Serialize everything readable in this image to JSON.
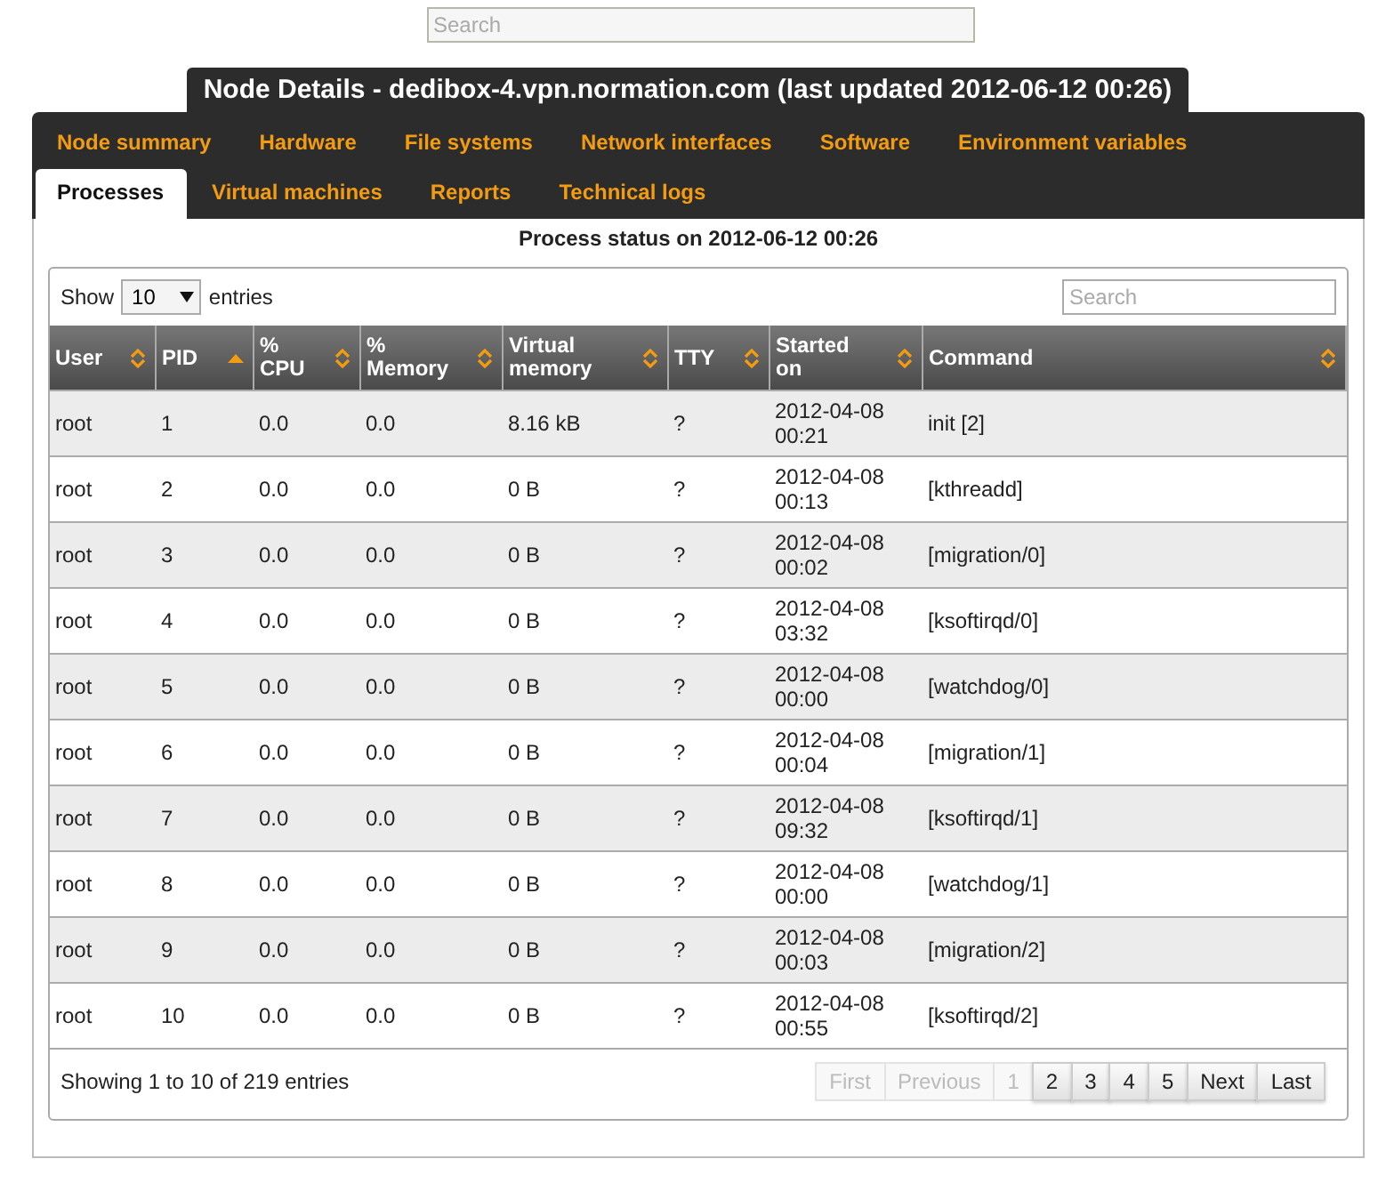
{
  "search": {
    "placeholder": "Search"
  },
  "title": "Node Details - dedibox-4.vpn.normation.com (last updated 2012-06-12 00:26)",
  "tabs": [
    {
      "label": "Node summary",
      "selected": false
    },
    {
      "label": "Hardware",
      "selected": false
    },
    {
      "label": "File systems",
      "selected": false
    },
    {
      "label": "Network interfaces",
      "selected": false
    },
    {
      "label": "Software",
      "selected": false
    },
    {
      "label": "Environment variables",
      "selected": false
    },
    {
      "label": "Processes",
      "selected": true
    },
    {
      "label": "Virtual machines",
      "selected": false
    },
    {
      "label": "Reports",
      "selected": false
    },
    {
      "label": "Technical logs",
      "selected": false
    }
  ],
  "panel_title": "Process status on 2012-06-12 00:26",
  "length_menu": {
    "before": "Show",
    "value": "10",
    "after": "entries"
  },
  "table_search": {
    "placeholder": "Search"
  },
  "table": {
    "columns": [
      {
        "label": "User",
        "sorted": false
      },
      {
        "label": "PID",
        "sorted": true
      },
      {
        "label": "% CPU",
        "sorted": false
      },
      {
        "label": "% Memory",
        "sorted": false
      },
      {
        "label": "Virtual memory",
        "sorted": false
      },
      {
        "label": "TTY",
        "sorted": false
      },
      {
        "label": "Started on",
        "sorted": false
      },
      {
        "label": "Command",
        "sorted": false
      }
    ],
    "rows": [
      [
        "root",
        "1",
        "0.0",
        "0.0",
        "8.16 kB",
        "?",
        "2012-04-08 00:21",
        "init [2]"
      ],
      [
        "root",
        "2",
        "0.0",
        "0.0",
        "0 B",
        "?",
        "2012-04-08 00:13",
        "[kthreadd]"
      ],
      [
        "root",
        "3",
        "0.0",
        "0.0",
        "0 B",
        "?",
        "2012-04-08 00:02",
        "[migration/0]"
      ],
      [
        "root",
        "4",
        "0.0",
        "0.0",
        "0 B",
        "?",
        "2012-04-08 03:32",
        "[ksoftirqd/0]"
      ],
      [
        "root",
        "5",
        "0.0",
        "0.0",
        "0 B",
        "?",
        "2012-04-08 00:00",
        "[watchdog/0]"
      ],
      [
        "root",
        "6",
        "0.0",
        "0.0",
        "0 B",
        "?",
        "2012-04-08 00:04",
        "[migration/1]"
      ],
      [
        "root",
        "7",
        "0.0",
        "0.0",
        "0 B",
        "?",
        "2012-04-08 09:32",
        "[ksoftirqd/1]"
      ],
      [
        "root",
        "8",
        "0.0",
        "0.0",
        "0 B",
        "?",
        "2012-04-08 00:00",
        "[watchdog/1]"
      ],
      [
        "root",
        "9",
        "0.0",
        "0.0",
        "0 B",
        "?",
        "2012-04-08 00:03",
        "[migration/2]"
      ],
      [
        "root",
        "10",
        "0.0",
        "0.0",
        "0 B",
        "?",
        "2012-04-08 00:55",
        "[ksoftirqd/2]"
      ]
    ]
  },
  "info": "Showing 1 to 10 of 219 entries",
  "pagination": [
    {
      "label": "First",
      "disabled": true
    },
    {
      "label": "Previous",
      "disabled": true
    },
    {
      "label": "1",
      "disabled": true
    },
    {
      "label": "2",
      "disabled": false
    },
    {
      "label": "3",
      "disabled": false
    },
    {
      "label": "4",
      "disabled": false
    },
    {
      "label": "5",
      "disabled": false
    },
    {
      "label": "Next",
      "disabled": false
    },
    {
      "label": "Last",
      "disabled": false
    }
  ]
}
